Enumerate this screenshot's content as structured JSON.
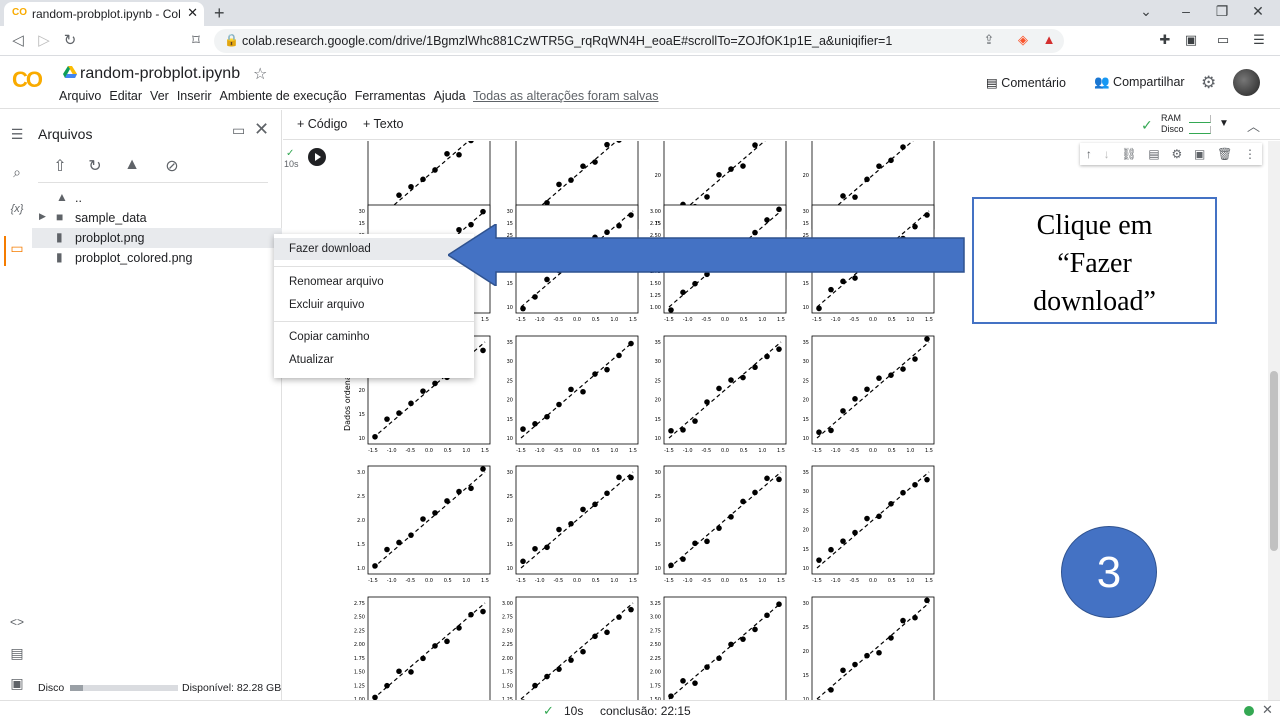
{
  "browser": {
    "tab_title": "random-probplot.ipynb - Colabor",
    "favicon": "CO",
    "url": "colab.research.google.com/drive/1BgmzlWhc881CzWTR5G_rqRqWN4H_eoaE#scrollTo=ZOJfOK1p1E_a&uniqifier=1"
  },
  "colab": {
    "logo": "CO",
    "notebook_title": "random-probplot.ipynb",
    "menu": [
      "Arquivo",
      "Editar",
      "Ver",
      "Inserir",
      "Ambiente de execução",
      "Ferramentas",
      "Ajuda"
    ],
    "save_status": "Todas as alterações foram salvas",
    "comment_label": "Comentário",
    "share_label": "Compartilhar"
  },
  "file_panel": {
    "title": "Arquivos",
    "items": [
      {
        "label": "..",
        "type": "folder-up"
      },
      {
        "label": "sample_data",
        "type": "folder"
      },
      {
        "label": "probplot.png",
        "type": "file",
        "selected": true
      },
      {
        "label": "probplot_colored.png",
        "type": "file"
      }
    ],
    "disk_label": "Disco",
    "disk_used_fraction": 0.12,
    "disk_free": "Disponível: 82.28 GB"
  },
  "context_menu": {
    "items": [
      "Fazer download",
      "Renomear arquivo",
      "Excluir arquivo",
      "Copiar caminho",
      "Atualizar"
    ]
  },
  "toolbar": {
    "add_code": "+ Código",
    "add_text": "+ Texto",
    "ram_label": "RAM",
    "disk_label": "Disco"
  },
  "cell": {
    "exec_time": "10s"
  },
  "plot": {
    "ylabel": "Dados ordena"
  },
  "annotation": {
    "callout_line1": "Clique em",
    "callout_line2": "“Fazer",
    "callout_line3": "download”",
    "step_number": "3",
    "arrow_color": "#4472c4"
  },
  "status_bar": {
    "time": "10s",
    "done": "conclusão: 22:15"
  },
  "chart_data": {
    "type": "scatter",
    "note_rows": 5,
    "xticks": [
      "-1.5",
      "-1.0",
      "-0.5",
      "0.0",
      "0.5",
      "1.0",
      "1.5"
    ],
    "panels_row_ticks": [
      [
        [
          "15",
          "20"
        ],
        [
          "15",
          "20"
        ],
        [
          "15",
          "20",
          "25"
        ],
        [
          "15",
          "20",
          "25"
        ]
      ],
      [
        [
          "10",
          "15",
          "20",
          "25",
          "30"
        ],
        [
          "10",
          "15",
          "20",
          "25",
          "30"
        ],
        [
          "1.00",
          "1.25",
          "1.50",
          "1.75",
          "2.00",
          "2.25",
          "2.50",
          "2.75",
          "3.00"
        ],
        [
          "10",
          "15",
          "20",
          "25",
          "30"
        ]
      ],
      [
        [
          "10",
          "15",
          "20",
          "25",
          "30"
        ],
        [
          "10",
          "15",
          "20",
          "25",
          "30",
          "35"
        ],
        [
          "10",
          "15",
          "20",
          "25",
          "30",
          "35"
        ],
        [
          "10",
          "15",
          "20",
          "25",
          "30",
          "35"
        ]
      ],
      [
        [
          "1.0",
          "1.5",
          "2.0",
          "2.5",
          "3.0"
        ],
        [
          "10",
          "15",
          "20",
          "25",
          "30"
        ],
        [
          "10",
          "15",
          "20",
          "25",
          "30"
        ],
        [
          "10",
          "15",
          "20",
          "25",
          "30",
          "35"
        ]
      ],
      [
        [
          "1.00",
          "1.25",
          "1.50",
          "1.75",
          "2.00",
          "2.25",
          "2.50",
          "2.75"
        ],
        [
          "1.25",
          "1.50",
          "1.75",
          "2.00",
          "2.25",
          "2.50",
          "2.75",
          "3.00"
        ],
        [
          "1.50",
          "1.75",
          "2.00",
          "2.25",
          "2.50",
          "2.75",
          "3.00",
          "3.25"
        ],
        [
          "10",
          "15",
          "20",
          "25",
          "30"
        ]
      ]
    ]
  }
}
